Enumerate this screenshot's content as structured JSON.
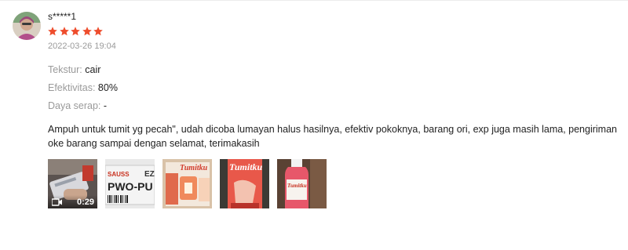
{
  "review": {
    "username": "s*****1",
    "rating": 5,
    "date": "2022-03-26 19:04",
    "attributes": [
      {
        "key": "Tekstur:",
        "value": "cair"
      },
      {
        "key": "Efektivitas:",
        "value": "80%"
      },
      {
        "key": "Daya serap:",
        "value": "-"
      }
    ],
    "comment": "Ampuh untuk tumit yg pecah\", udah dicoba lumayan halus hasilnya, efektiv pokoknya, barang ori, exp juga masih lama, pengiriman oke barang sampai dengan selamat, terimakasih",
    "media": [
      {
        "type": "video",
        "duration": "0:29",
        "icon": "video-camera-icon"
      },
      {
        "type": "image",
        "text": "PWO-PU",
        "corner": "EZ",
        "brand": "SAUSS"
      },
      {
        "type": "image",
        "text": "Tumitku"
      },
      {
        "type": "image",
        "text": "Tumitku"
      },
      {
        "type": "image",
        "text": "Tumitku"
      }
    ]
  },
  "colors": {
    "star": "#ee4d2d",
    "muted": "#9a9a9a",
    "text": "#222222"
  }
}
